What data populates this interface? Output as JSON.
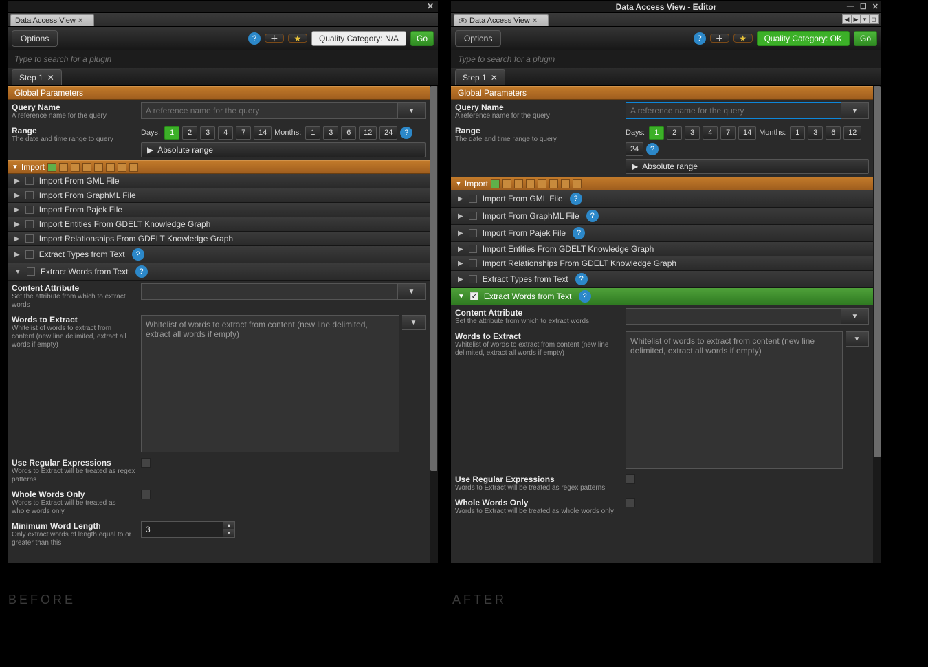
{
  "captions": {
    "before": "BEFORE",
    "after": "AFTER"
  },
  "left": {
    "title": "",
    "tab": "Data Access View",
    "options": "Options",
    "quality": "Quality Category: N/A",
    "go": "Go",
    "search_ph": "Type to search for a plugin",
    "step": "Step 1",
    "globalhdr": "Global Parameters",
    "query": {
      "name": "Query Name",
      "desc": "A reference name for the query",
      "ph": "A reference name for the query"
    },
    "range": {
      "name": "Range",
      "desc": "The date and time range to query",
      "days_lbl": "Days:",
      "months_lbl": "Months:",
      "days": [
        "1",
        "2",
        "3",
        "4",
        "7",
        "14"
      ],
      "months": [
        "1",
        "3",
        "6",
        "12",
        "24"
      ],
      "abs": "Absolute range"
    },
    "import_lbl": "Import",
    "plugins": [
      {
        "label": "Import From GML File",
        "help": false
      },
      {
        "label": "Import From GraphML File",
        "help": false
      },
      {
        "label": "Import From Pajek File",
        "help": false
      },
      {
        "label": "Import Entities From GDELT Knowledge Graph",
        "help": false
      },
      {
        "label": "Import Relationships From GDELT Knowledge Graph",
        "help": false
      },
      {
        "label": "Extract Types from Text",
        "help": true
      }
    ],
    "active_plugin": "Extract Words from Text",
    "content_attr": {
      "name": "Content Attribute",
      "desc": "Set the attribute from which to extract words"
    },
    "words": {
      "name": "Words to Extract",
      "desc": "Whitelist of words to extract from content (new line delimited, extract all words if empty)",
      "ph": "Whitelist of words to extract from content\n(new line delimited, extract all words if empty)"
    },
    "regex": {
      "name": "Use Regular Expressions",
      "desc": "Words to Extract will be treated as regex patterns"
    },
    "whole": {
      "name": "Whole Words Only",
      "desc": "Words to Extract will be treated as whole words only"
    },
    "minlen": {
      "name": "Minimum Word Length",
      "desc": "Only extract words of length equal to or greater than this",
      "val": "3"
    }
  },
  "right": {
    "title": "Data Access View - Editor",
    "tab": "Data Access View",
    "options": "Options",
    "quality": "Quality Category: OK",
    "go": "Go",
    "search_ph": "Type to search for a plugin",
    "step": "Step 1",
    "globalhdr": "Global Parameters",
    "query": {
      "name": "Query Name",
      "desc": "A reference name for the query",
      "ph": "A reference name for the query"
    },
    "range": {
      "name": "Range",
      "desc": "The date and time range to query",
      "days_lbl": "Days:",
      "months_lbl": "Months:",
      "days": [
        "1",
        "2",
        "3",
        "4",
        "7",
        "14"
      ],
      "months": [
        "1",
        "3",
        "6",
        "12",
        "24"
      ],
      "abs": "Absolute range"
    },
    "import_lbl": "Import",
    "plugins": [
      {
        "label": "Import From GML File",
        "help": true
      },
      {
        "label": "Import From GraphML File",
        "help": true
      },
      {
        "label": "Import From Pajek File",
        "help": true
      },
      {
        "label": "Import Entities From GDELT Knowledge Graph",
        "help": false
      },
      {
        "label": "Import Relationships From GDELT Knowledge Graph",
        "help": false
      },
      {
        "label": "Extract Types from Text",
        "help": true
      }
    ],
    "active_plugin": "Extract Words from Text",
    "content_attr": {
      "name": "Content Attribute",
      "desc": "Set the attribute from which to extract words"
    },
    "words": {
      "name": "Words to Extract",
      "desc": "Whitelist of words to extract from content (new line delimited, extract all words if empty)",
      "ph": "Whitelist of words to extract from content\n(new line delimited, extract all words if empty)"
    },
    "regex": {
      "name": "Use Regular Expressions",
      "desc": "Words to Extract will be treated as regex patterns"
    },
    "whole": {
      "name": "Whole Words Only",
      "desc": "Words to Extract will be treated as whole words only"
    }
  }
}
